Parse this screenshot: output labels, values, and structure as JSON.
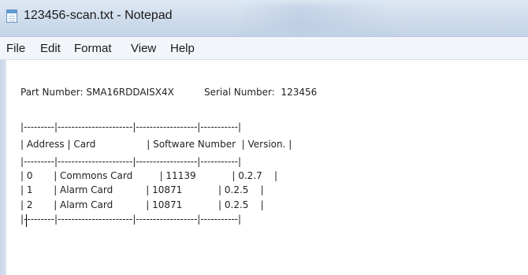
{
  "window": {
    "title": "123456-scan.txt - Notepad",
    "icon": "notepad-icon"
  },
  "menu": {
    "file": "File",
    "edit": "Edit",
    "format": "Format",
    "view": "View",
    "help": "Help"
  },
  "document": {
    "lines": [
      "Part Number: SMA16RDDAISX4X          Serial Number:  123456",
      "|---------|----------------------|------------------|-----------|",
      "| Address | Card                 | Software Number  | Version. |",
      "|---------|----------------------|------------------|-----------|",
      "| 0       | Commons Card         | 11139            | 0.2.7    |",
      "| 1       | Alarm Card           | 10871            | 0.2.5    |",
      "| 2       | Alarm Card           | 10871            | 0.2.5    |",
      "|---------|----------------------|------------------|-----------|"
    ]
  }
}
